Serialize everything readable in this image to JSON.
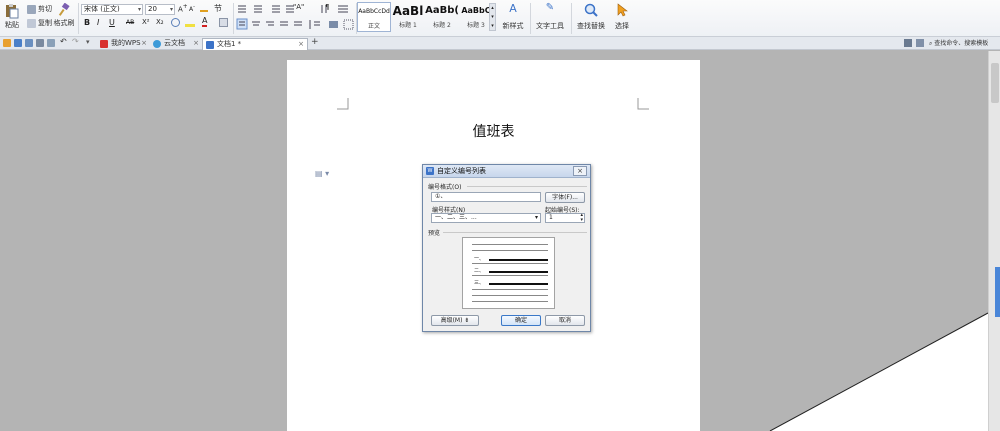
{
  "ribbon": {
    "paste": "粘贴",
    "cut": "剪切",
    "copy": "复制",
    "format_painter": "格式刷",
    "font_name": "宋体 (正文)",
    "font_size": "20",
    "styles": [
      {
        "preview": "AaBbCcDd",
        "label": "正文"
      },
      {
        "preview": "AaBl",
        "label": "标题 1"
      },
      {
        "preview": "AaBb(",
        "label": "标题 2"
      },
      {
        "preview": "AaBbC",
        "label": "标题 3"
      }
    ],
    "new_style": "新样式",
    "text_tools": "文字工具",
    "find_replace": "查找替换",
    "select": "选择"
  },
  "tabs": {
    "my_wps": "我的WPS",
    "cloud_docs": "云文档",
    "doc1": "文档1 *",
    "search": "查找命令、搜索模板"
  },
  "document": {
    "title": "值班表"
  },
  "dialog": {
    "title": "自定义编号列表",
    "number_format_label": "编号格式(O)",
    "number_format_value": "①、",
    "font_button": "字体(F)...",
    "number_style_label": "编号样式(N)",
    "number_style_value": "一、二、三、...",
    "start_at_label": "起始编号(S):",
    "start_at_value": "1",
    "preview_label": "预览",
    "preview_items": [
      "一、",
      "二、",
      "三、"
    ],
    "advanced_button": "高级(M) ⇟",
    "ok_button": "确定",
    "cancel_button": "取消"
  },
  "colors": {
    "accent": "#3c73c8",
    "ribbon_bg": "#eef1f5",
    "workspace_bg": "#b4b4b4"
  }
}
